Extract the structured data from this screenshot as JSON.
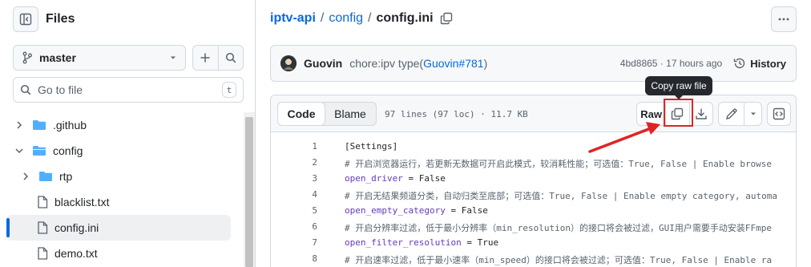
{
  "sidebar": {
    "title": "Files",
    "branch": "master",
    "search_placeholder": "Go to file",
    "search_shortcut": "t",
    "tree": [
      {
        "name": ".github",
        "type": "folder",
        "expanded": false
      },
      {
        "name": "config",
        "type": "folder",
        "expanded": true
      },
      {
        "name": "rtp",
        "type": "folder",
        "expanded": false
      },
      {
        "name": "blacklist.txt",
        "type": "file"
      },
      {
        "name": "config.ini",
        "type": "file",
        "active": true
      },
      {
        "name": "demo.txt",
        "type": "file"
      }
    ]
  },
  "breadcrumb": {
    "repo": "iptv-api",
    "sep1": "/",
    "folder": "config",
    "sep2": "/",
    "file": "config.ini"
  },
  "commit": {
    "author": "Guovin",
    "message": "chore:ipv type(",
    "link": "Guovin#781",
    "message_end": ")",
    "sha_time": "4bd8865 · 17 hours ago",
    "history_label": "History"
  },
  "file": {
    "tab_code": "Code",
    "tab_blame": "Blame",
    "info": "97 lines (97 loc) · 11.7 KB",
    "raw_label": "Raw",
    "tooltip": "Copy raw file"
  },
  "code_lines": [
    {
      "n": "1",
      "text": "[Settings]",
      "kind": "section"
    },
    {
      "n": "2",
      "text": "# 开启浏览器运行，若更新无数据可开启此模式，较消耗性能；可选值：True, False | Enable browse",
      "kind": "comment"
    },
    {
      "n": "3",
      "key": "open_driver",
      "rest": " = False",
      "kind": "kv"
    },
    {
      "n": "4",
      "text": "# 开启无结果频道分类，自动归类至底部；可选值：True, False | Enable empty category, automa",
      "kind": "comment"
    },
    {
      "n": "5",
      "key": "open_empty_category",
      "rest": " = False",
      "kind": "kv"
    },
    {
      "n": "6",
      "text": "# 开启分辨率过滤，低于最小分辨率（min_resolution）的接口将会被过滤，GUI用户需要手动安装FFmpe",
      "kind": "comment"
    },
    {
      "n": "7",
      "key": "open_filter_resolution",
      "rest": " = True",
      "kind": "kv"
    },
    {
      "n": "8",
      "text": "# 开启速率过滤，低于最小速率（min_speed）的接口将会被过滤；可选值：True, False | Enable ra",
      "kind": "comment"
    }
  ],
  "colors": {
    "link": "#0969da",
    "annotation_red": "#e02424"
  }
}
